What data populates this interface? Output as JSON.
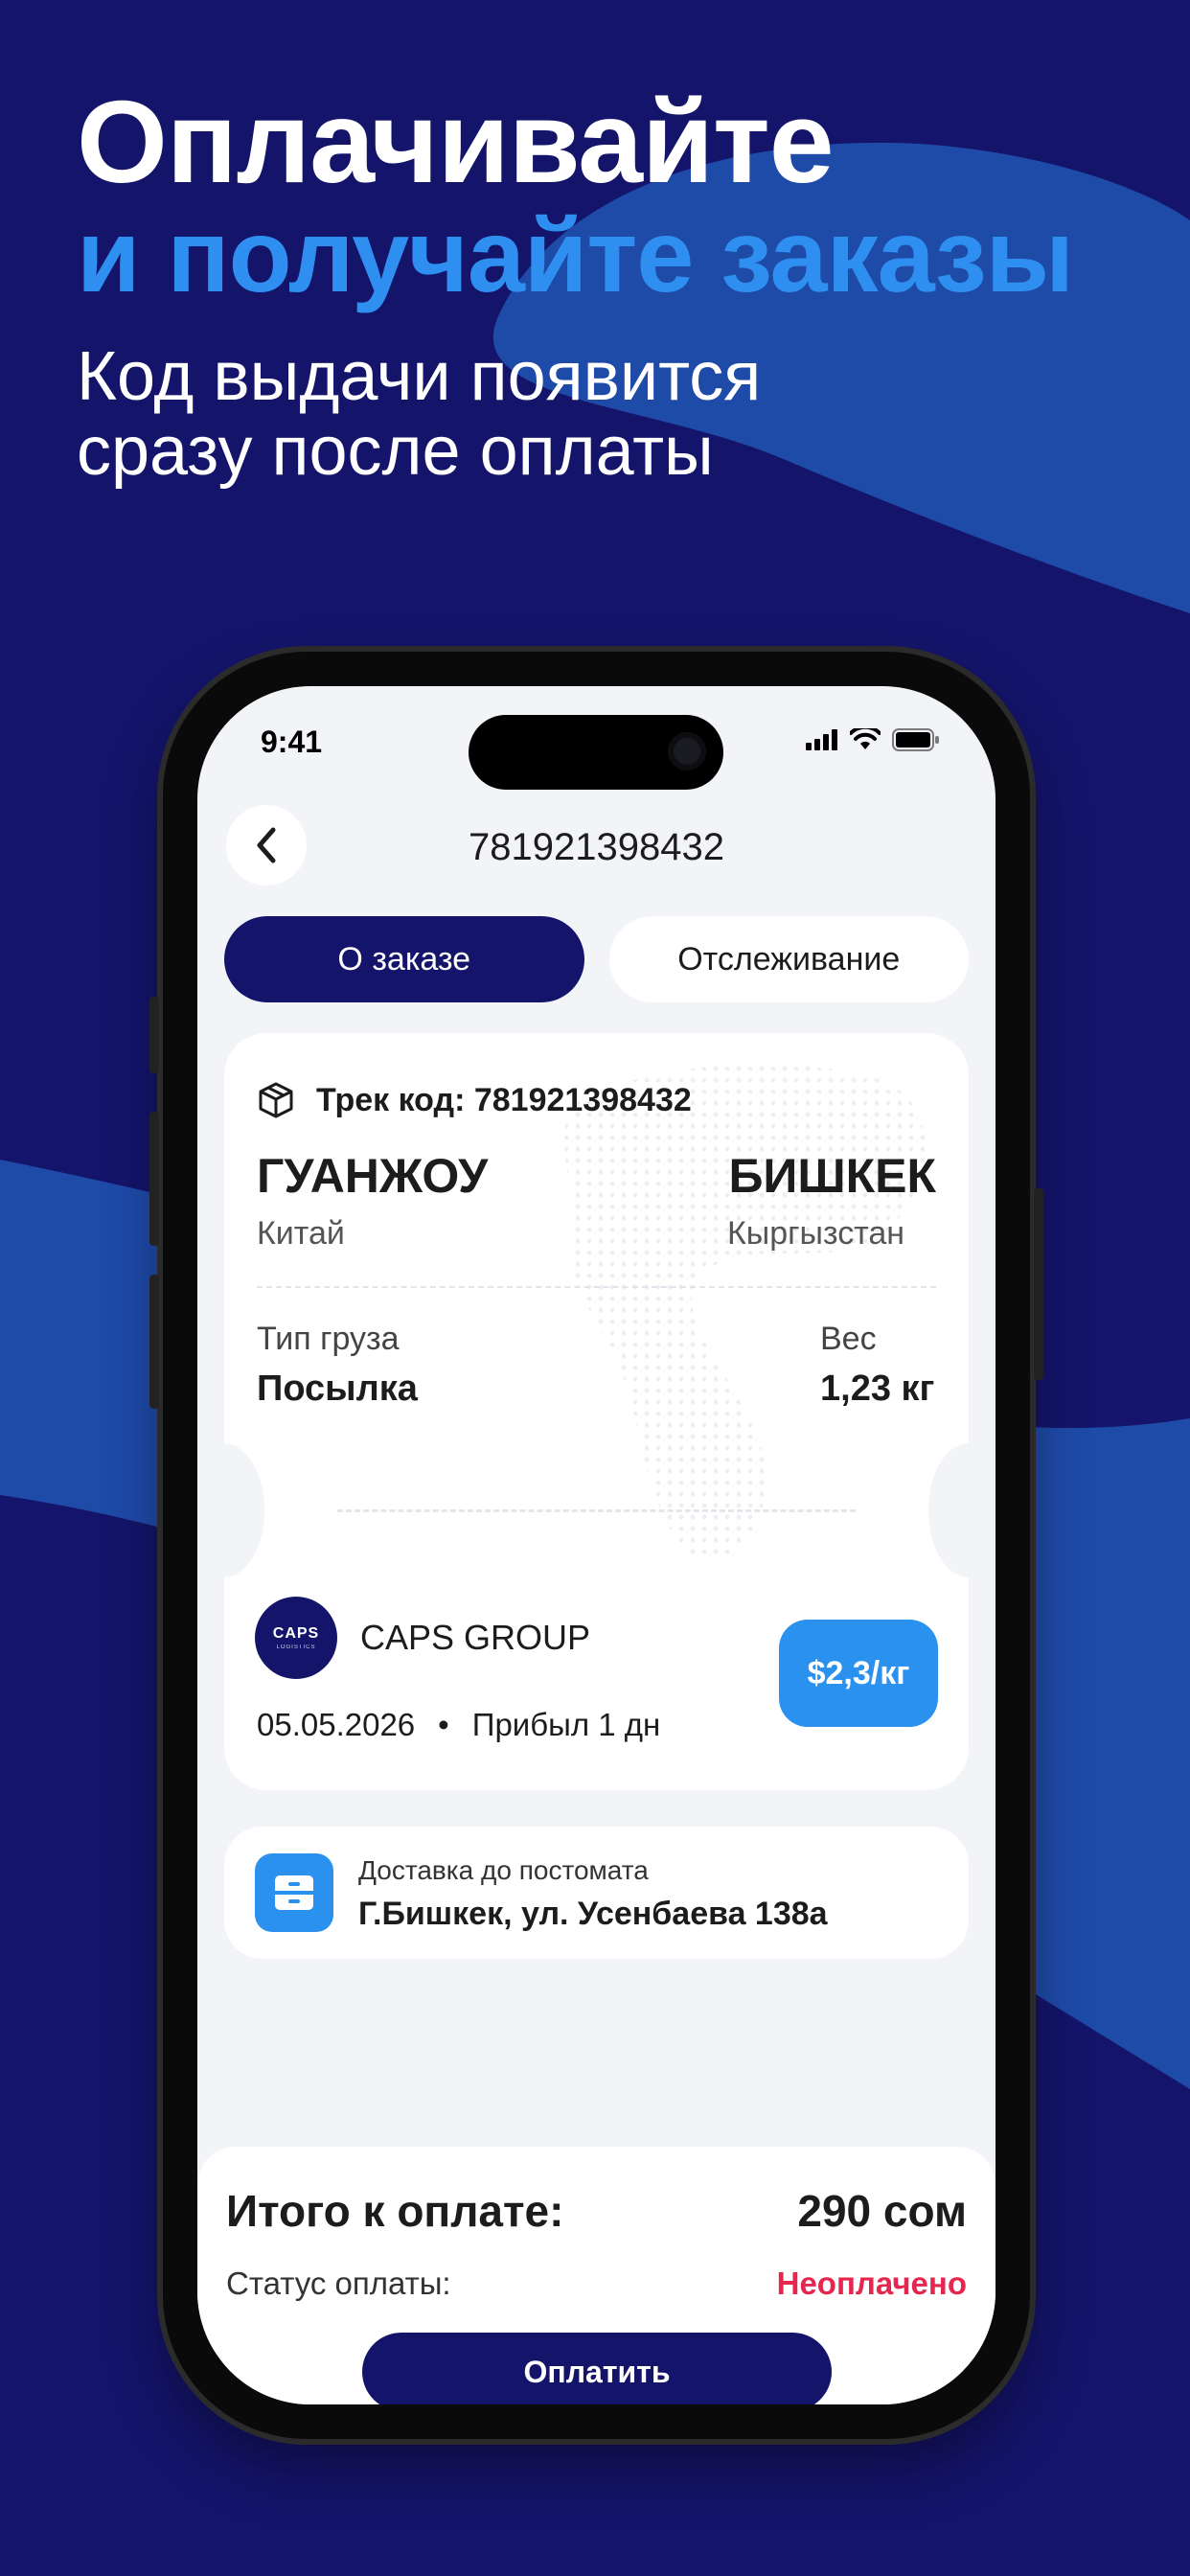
{
  "promo": {
    "line1": "Оплачивайте",
    "line2": "и получайте заказы",
    "subline1": "Код выдачи появится",
    "subline2": "сразу после оплаты"
  },
  "status_bar": {
    "time": "9:41"
  },
  "header": {
    "title": "781921398432",
    "back_icon": "chevron-left-icon"
  },
  "tabs": [
    {
      "label": "О заказе",
      "active": true
    },
    {
      "label": "Отслеживание",
      "active": false
    }
  ],
  "order": {
    "track_label": "Трек код: 781921398432",
    "from_city": "ГУАНЖОУ",
    "from_country": "Китай",
    "to_city": "БИШКЕК",
    "to_country": "Кыргызстан",
    "cargo_type_label": "Тип груза",
    "cargo_type_value": "Посылка",
    "weight_label": "Вес",
    "weight_value": "1,23 кг",
    "carrier_logo_text": "CAPS",
    "carrier_logo_sub": "LOGISTICS",
    "carrier_name": "CAPS GROUP",
    "date": "05.05.2026",
    "bullet": "•",
    "arrival": "Прибыл 1 дн",
    "price": "$2,3/кг"
  },
  "delivery": {
    "label": "Доставка до постомата",
    "address": "Г.Бишкек, ул. Усенбаева 138а"
  },
  "payment": {
    "total_label": "Итого к оплате:",
    "total_value": "290 сом",
    "status_label": "Статус оплаты:",
    "status_value": "Неоплачено",
    "pay_button": "Оплатить"
  },
  "colors": {
    "background": "#14146b",
    "accent_blue": "#2b91ee",
    "unpaid_red": "#e5274f"
  }
}
